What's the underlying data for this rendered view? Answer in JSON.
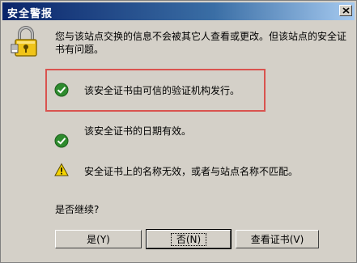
{
  "window": {
    "title": "安全警报"
  },
  "intro_text": "您与该站点交换的信息不会被其它人查看或更改。但该站点的安全证书有问题。",
  "items": [
    {
      "icon": "check-icon",
      "text": "该安全证书由可信的验证机构发行。"
    },
    {
      "icon": "check-icon",
      "text": "该安全证书的日期有效。"
    },
    {
      "icon": "warning-icon",
      "text": "安全证书上的名称无效，或者与站点名称不匹配。"
    }
  ],
  "question": "是否继续?",
  "buttons": {
    "yes": "是(Y)",
    "no": "否(N)",
    "view_cert": "查看证书(V)"
  },
  "colors": {
    "title_gradient_start": "#0a246a",
    "title_gradient_end": "#a6caf0",
    "check_green": "#2e8b2e",
    "warning_yellow": "#f5d400",
    "highlight_red": "#d9534f"
  }
}
